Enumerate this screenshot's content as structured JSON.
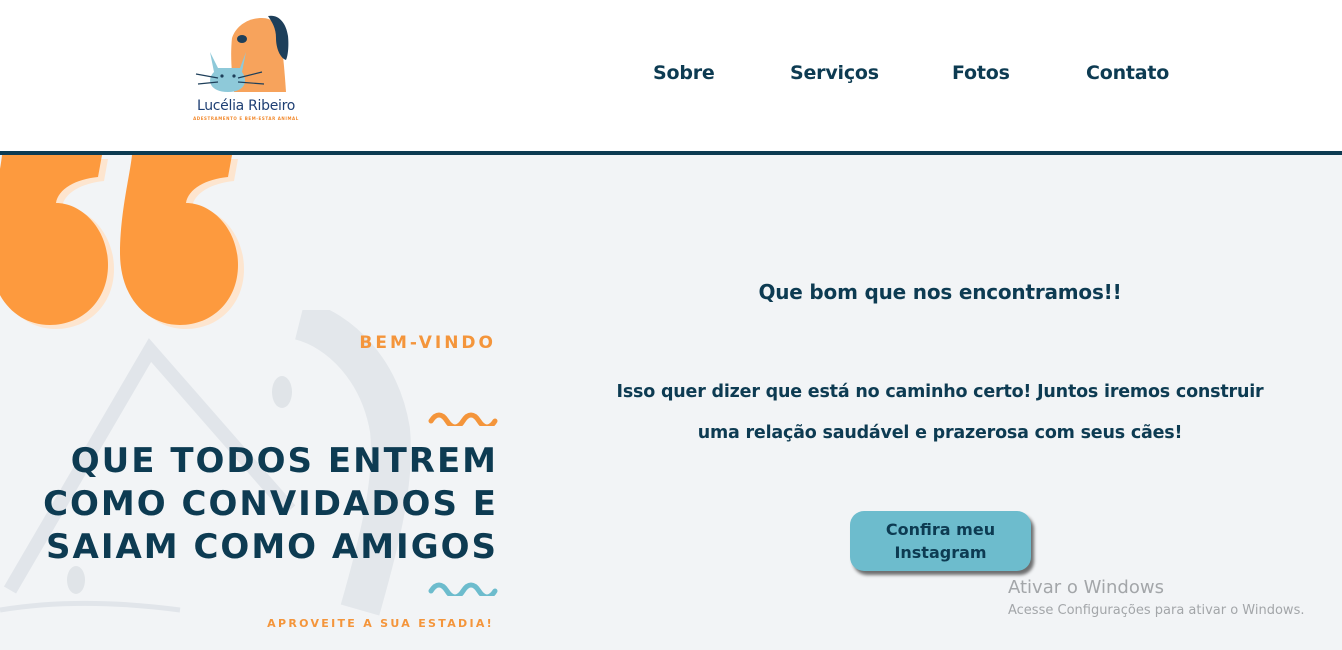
{
  "header": {
    "logo": {
      "name": "Lucélia Ribeiro",
      "tagline": "ADESTRAMENTO E BEM-ESTAR ANIMAL",
      "icon": "dog-and-cat-logo"
    },
    "nav": [
      {
        "label": "Sobre"
      },
      {
        "label": "Serviços"
      },
      {
        "label": "Fotos"
      },
      {
        "label": "Contato"
      }
    ]
  },
  "hero": {
    "quote_icon": "quotation-mark-icon",
    "welcome": "BEM-VINDO",
    "headline": [
      "QUE TODOS ENTREM",
      "COMO CONVIDADOS E",
      "SAIAM COMO AMIGOS"
    ],
    "enjoy": "APROVEITE A SUA ESTADIA!",
    "intro_title": "Que bom que nos encontramos!!",
    "intro_text": [
      "Isso quer dizer que está no caminho certo! Juntos iremos construir",
      "uma relação saudável e prazerosa com seus cães!"
    ],
    "cta": [
      "Confira meu",
      "Instagram"
    ]
  },
  "os_watermark": {
    "title": "Ativar o Windows",
    "subtitle": "Acesse Configurações para ativar o Windows."
  },
  "colors": {
    "primary": "#0d3b52",
    "accent_orange": "#f4953b",
    "accent_blue": "#6dbccd",
    "background": "#f2f4f6"
  }
}
